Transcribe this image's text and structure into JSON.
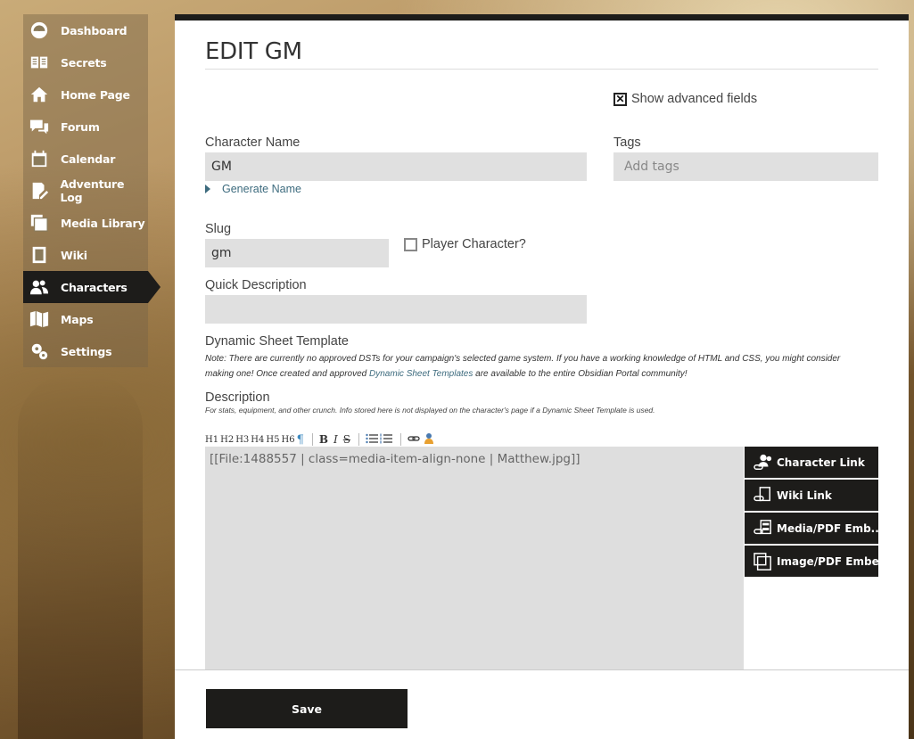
{
  "sidebar": {
    "items": [
      {
        "label": "Dashboard",
        "icon": "dashboard-icon"
      },
      {
        "label": "Secrets",
        "icon": "secrets-icon"
      },
      {
        "label": "Home Page",
        "icon": "home-icon"
      },
      {
        "label": "Forum",
        "icon": "forum-icon"
      },
      {
        "label": "Calendar",
        "icon": "calendar-icon"
      },
      {
        "label": "Adventure Log",
        "icon": "adventure-log-icon"
      },
      {
        "label": "Media Library",
        "icon": "media-library-icon"
      },
      {
        "label": "Wiki",
        "icon": "wiki-icon"
      },
      {
        "label": "Characters",
        "icon": "characters-icon",
        "active": true
      },
      {
        "label": "Maps",
        "icon": "maps-icon"
      },
      {
        "label": "Settings",
        "icon": "settings-icon"
      }
    ]
  },
  "page": {
    "title": "EDIT GM",
    "show_advanced": {
      "label": "Show advanced fields",
      "checked": true,
      "mark": "✕"
    }
  },
  "form": {
    "character_name": {
      "label": "Character Name",
      "value": "GM"
    },
    "generate_name": "Generate Name",
    "tags": {
      "label": "Tags",
      "placeholder": "Add tags"
    },
    "slug": {
      "label": "Slug",
      "value": "gm"
    },
    "player_character": {
      "label": "Player Character?",
      "checked": false
    },
    "quick_description": {
      "label": "Quick Description",
      "value": ""
    },
    "dst": {
      "label": "Dynamic Sheet Template",
      "note_part1": "Note: There are currently no approved DSTs for your campaign's selected game system. If you have a working knowledge of HTML and CSS, you might consider making one! Once created and approved ",
      "note_link": "Dynamic Sheet Templates",
      "note_part2": " are available to the entire Obsidian Portal community!"
    },
    "description": {
      "label": "Description",
      "note": "For stats, equipment, and other crunch. Info stored here is not displayed on the character's page if a Dynamic Sheet Template is used.",
      "value": "[[File:1488557  | class=media-item-align-none | Matthew.jpg]]"
    }
  },
  "toolbar": {
    "h1": "H1",
    "h2": "H2",
    "h3": "H3",
    "h4": "H4",
    "h5": "H5",
    "h6": "H6",
    "para": "¶",
    "bold": "B",
    "italic": "I",
    "strike": "S"
  },
  "insert_buttons": [
    {
      "label": "Character Link",
      "icon": "character-link-icon"
    },
    {
      "label": "Wiki Link",
      "icon": "wiki-link-icon"
    },
    {
      "label": "Media/PDF Emb...",
      "icon": "media-embed-icon"
    },
    {
      "label": "Image/PDF Embed",
      "icon": "image-embed-icon"
    }
  ],
  "save_label": "Save",
  "colors": {
    "dark": "#1d1c1a",
    "link": "#3d6b7e",
    "field": "#e0e0e0"
  }
}
